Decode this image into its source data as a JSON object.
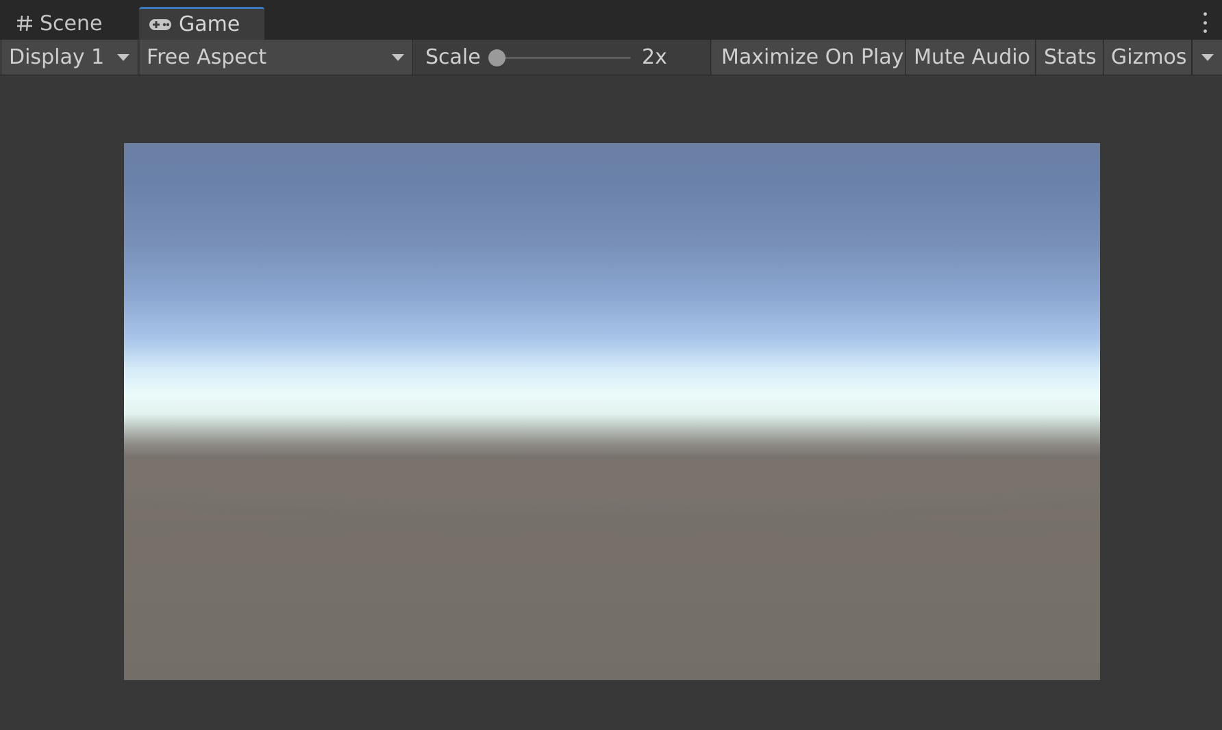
{
  "tabs": [
    {
      "label": "Scene",
      "icon": "grid-icon",
      "active": false
    },
    {
      "label": "Game",
      "icon": "gamepad-icon",
      "active": true
    }
  ],
  "toolbar": {
    "display": {
      "selected": "Display 1"
    },
    "aspect": {
      "selected": "Free Aspect"
    },
    "scale": {
      "label": "Scale",
      "value_label": "2x",
      "slider_fraction": 0.0
    },
    "maximize_on_play": "Maximize On Play",
    "mute_audio": "Mute Audio",
    "stats": "Stats",
    "gizmos": "Gizmos"
  },
  "colors": {
    "accent_tab_border": "#3a79bb",
    "panel_bg": "#383838",
    "toolbar_bg": "#3c3c3c",
    "button_bg": "#474747",
    "sky_top": "#6c80a4",
    "horizon_light": "#ecfbfb",
    "ground": "#757069"
  }
}
